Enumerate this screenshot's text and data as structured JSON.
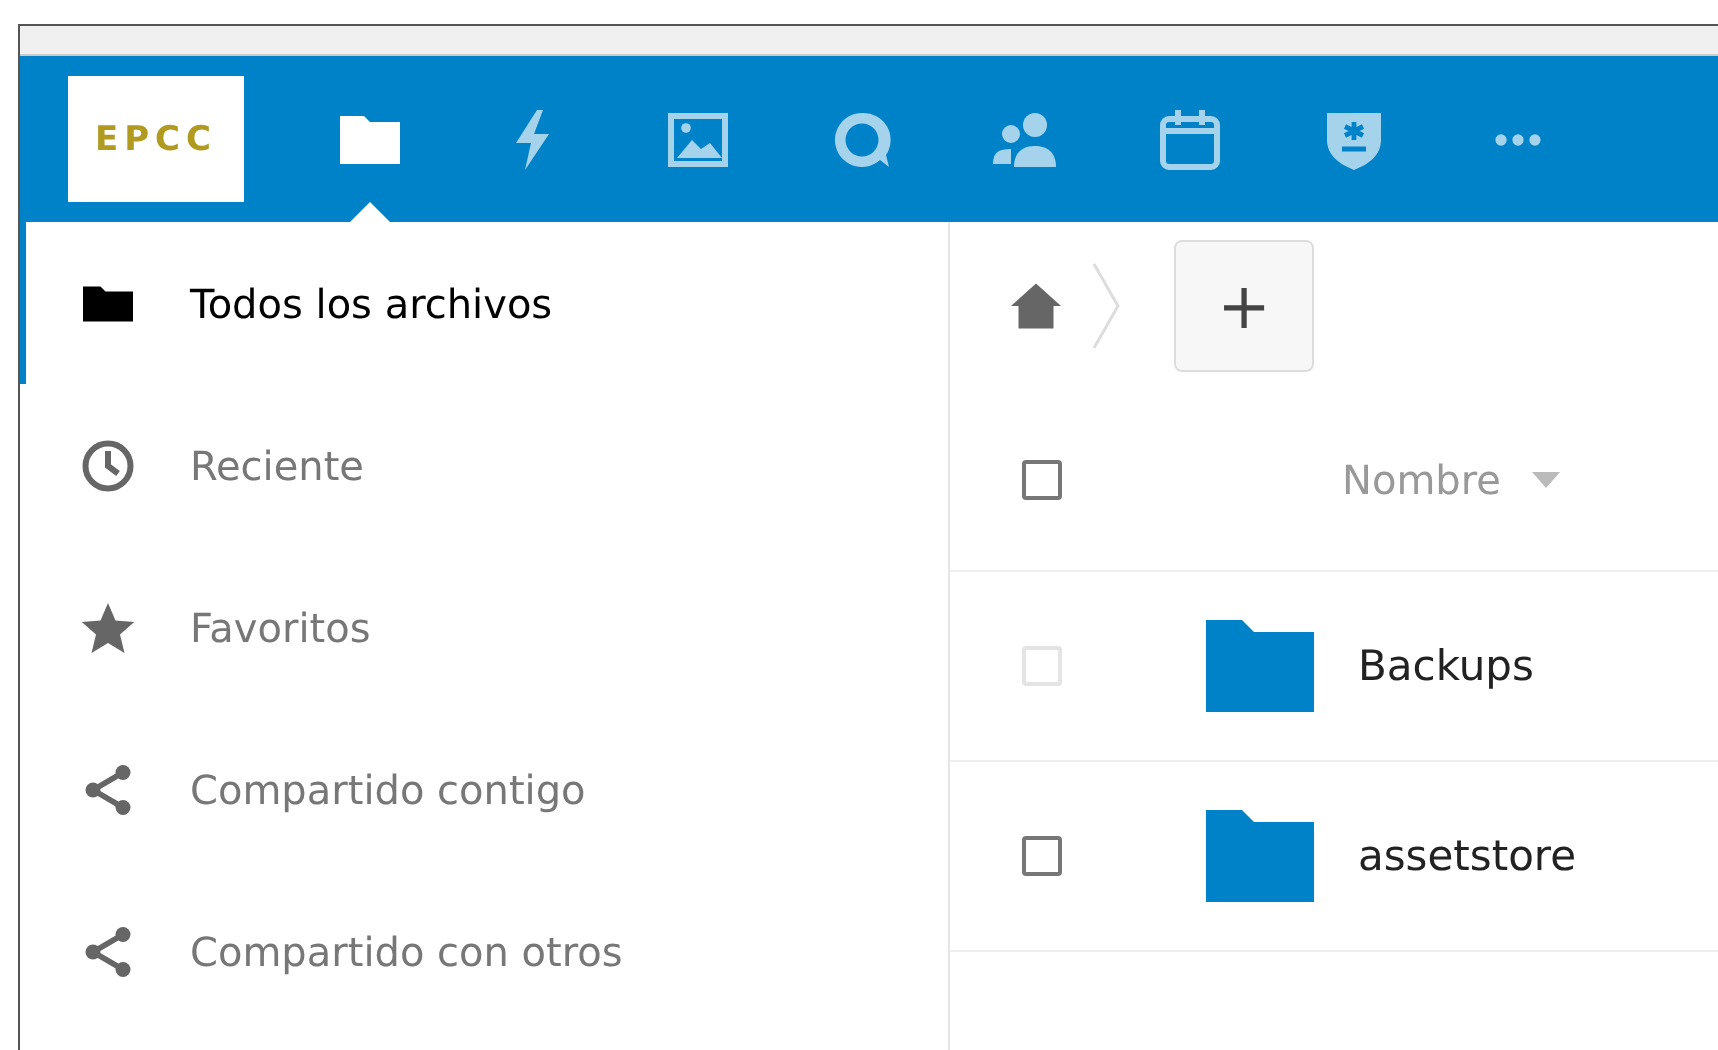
{
  "header": {
    "logo_text": "EPCC",
    "apps": [
      {
        "kind": "files",
        "selected": true
      },
      {
        "kind": "activity",
        "selected": false
      },
      {
        "kind": "gallery",
        "selected": false
      },
      {
        "kind": "talk",
        "selected": false
      },
      {
        "kind": "contacts",
        "selected": false
      },
      {
        "kind": "calendar",
        "selected": false
      },
      {
        "kind": "shield",
        "selected": false
      },
      {
        "kind": "more",
        "selected": false
      }
    ]
  },
  "sidebar": {
    "items": [
      {
        "kind": "folder",
        "label": "Todos los archivos",
        "selected": true
      },
      {
        "kind": "clock",
        "label": "Reciente",
        "selected": false
      },
      {
        "kind": "star",
        "label": "Favoritos",
        "selected": false
      },
      {
        "kind": "share",
        "label": "Compartido contigo",
        "selected": false
      },
      {
        "kind": "share",
        "label": "Compartido con otros",
        "selected": false
      }
    ]
  },
  "breadcrumb": {
    "new_button": "+"
  },
  "table": {
    "columns": [
      {
        "label": "Nombre",
        "sorted": true
      }
    ],
    "select_all": {
      "checked": false
    },
    "rows": [
      {
        "name": "Backups",
        "checked": false,
        "faded": true
      },
      {
        "name": "assetstore",
        "checked": false,
        "faded": false
      }
    ]
  }
}
